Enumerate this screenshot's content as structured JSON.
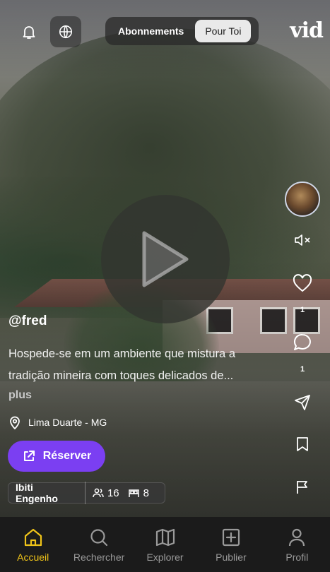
{
  "header": {
    "tabs": [
      {
        "label": "Abonnements",
        "active": false
      },
      {
        "label": "Pour Toi",
        "active": true
      }
    ],
    "brand": "vid",
    "icons": [
      "bell-icon",
      "globe-icon"
    ]
  },
  "video": {
    "state": "paused",
    "play_icon": "play-icon"
  },
  "rail": {
    "mute_icon": "volume-mute-icon",
    "likes": "1",
    "comments": "1",
    "share_icon": "send-icon",
    "save_icon": "bookmark-icon",
    "report_icon": "flag-icon"
  },
  "post": {
    "username": "@fred",
    "description": "Hospede-se em um ambiente que mistura a tradição mineira com toques delicados de...",
    "more_label": "plus",
    "location": "Lima Duarte - MG",
    "reserve_label": "Réserver",
    "venue": {
      "name": "Ibiti Engenho",
      "guests": "16",
      "beds": "8"
    }
  },
  "nav": {
    "items": [
      {
        "label": "Accueil",
        "icon": "home-icon",
        "active": true
      },
      {
        "label": "Rechercher",
        "icon": "search-icon",
        "active": false
      },
      {
        "label": "Explorer",
        "icon": "map-icon",
        "active": false
      },
      {
        "label": "Publier",
        "icon": "plus-square-icon",
        "active": false
      },
      {
        "label": "Profil",
        "icon": "user-icon",
        "active": false
      }
    ]
  },
  "colors": {
    "accent": "#7b3ff2",
    "nav_active": "#f0c419",
    "nav_bg": "#1b1b1b"
  }
}
